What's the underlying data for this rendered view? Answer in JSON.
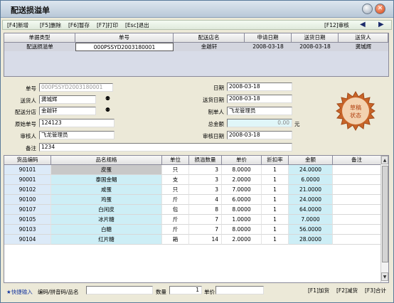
{
  "window": {
    "title": "配送损溢单"
  },
  "toolbar": {
    "new": "[F4]新增",
    "delete": "[F5]删除",
    "hold": "[F6]暂存",
    "print": "[F7]打印",
    "exit": "[Esc]退出",
    "review": "[F12]审核"
  },
  "header_table": {
    "columns": [
      "单据类型",
      "单号",
      "配送店名",
      "申请日期",
      "送货日期",
      "送货人"
    ],
    "row": [
      "配送损溢单",
      "000PSSYD2003180001",
      "金越轩",
      "2008-03-18",
      "2008-03-18",
      "龚城辉"
    ]
  },
  "form": {
    "doc_no_label": "单号",
    "doc_no": "000PSSYD2003180001",
    "sender_label": "送货人",
    "sender": "龚城辉",
    "branch_label": "配送分店",
    "branch": "金越轩",
    "orig_no_label": "原始单号",
    "orig_no": "124123",
    "reviewer_label": "审核人",
    "reviewer": "飞龙管理员",
    "remark_label": "备注",
    "remark": "1234",
    "date_label": "日期",
    "date": "2008-03-18",
    "delivery_date_label": "送货日期",
    "delivery_date": "2008-03-18",
    "maker_label": "制单人",
    "maker": "飞龙管理员",
    "total_label": "总金额",
    "total": "0.00",
    "total_unit": "元",
    "review_date_label": "审核日期",
    "review_date": "2008-03-18",
    "stamp_line1": "草稿",
    "stamp_line2": "状态"
  },
  "detail_table": {
    "columns": [
      "货品编码",
      "品名规格",
      "单位",
      "损溢数量",
      "单价",
      "折扣率",
      "金额",
      "备注"
    ],
    "rows": [
      [
        "90101",
        "皮蛋",
        "只",
        "3",
        "8.0000",
        "1",
        "24.0000",
        ""
      ],
      [
        "90001",
        "泰国金鲳",
        "支",
        "3",
        "2.0000",
        "1",
        "6.0000",
        ""
      ],
      [
        "90102",
        "咸蛋",
        "只",
        "3",
        "7.0000",
        "1",
        "21.0000",
        ""
      ],
      [
        "90100",
        "鸡蛋",
        "斤",
        "4",
        "6.0000",
        "1",
        "24.0000",
        ""
      ],
      [
        "90107",
        "白闲皮",
        "包",
        "8",
        "8.0000",
        "1",
        "64.0000",
        ""
      ],
      [
        "90105",
        "冰片糖",
        "斤",
        "7",
        "1.0000",
        "1",
        "7.0000",
        ""
      ],
      [
        "90103",
        "白糖",
        "斤",
        "7",
        "8.0000",
        "1",
        "56.0000",
        ""
      ],
      [
        "90104",
        "红片糖",
        "箱",
        "14",
        "2.0000",
        "1",
        "28.0000",
        ""
      ]
    ]
  },
  "bottom": {
    "quick_input": "★快捷输入",
    "code_label": "编码/拼音码/品名",
    "qty_label": "数量",
    "qty_value": "1",
    "price_label": "单价",
    "price_value": "",
    "f1": "[F1]加货",
    "f2": "[F2]减货",
    "f3": "[F3]合计"
  },
  "colors": {
    "title_bg": "#b9c8d8",
    "detail_highlight": "#cdeef6",
    "stamp": "#c86428"
  }
}
